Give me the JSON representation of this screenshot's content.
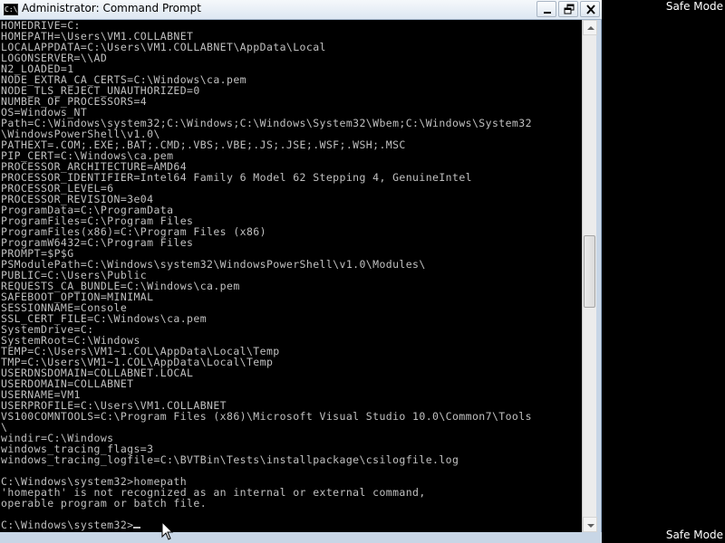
{
  "desktop": {
    "safe_mode_top": "Safe Mode",
    "safe_mode_bottom": "Safe Mode"
  },
  "window": {
    "title": "Administrator: Command Prompt",
    "icon_text": "C:\\",
    "controls": {
      "minimize": "minimize-icon",
      "maximize": "restore-icon",
      "close": "close-icon"
    }
  },
  "console": {
    "text_color": "#c0c0c0",
    "background": "#000000",
    "lines": [
      "HOMEDRIVE=C:",
      "HOMEPATH=\\Users\\VM1.COLLABNET",
      "LOCALAPPDATA=C:\\Users\\VM1.COLLABNET\\AppData\\Local",
      "LOGONSERVER=\\\\AD",
      "N2_LOADED=1",
      "NODE_EXTRA_CA_CERTS=C:\\Windows\\ca.pem",
      "NODE_TLS_REJECT_UNAUTHORIZED=0",
      "NUMBER_OF_PROCESSORS=4",
      "OS=Windows_NT",
      "Path=C:\\Windows\\system32;C:\\Windows;C:\\Windows\\System32\\Wbem;C:\\Windows\\System32",
      "\\WindowsPowerShell\\v1.0\\",
      "PATHEXT=.COM;.EXE;.BAT;.CMD;.VBS;.VBE;.JS;.JSE;.WSF;.WSH;.MSC",
      "PIP_CERT=C:\\Windows\\ca.pem",
      "PROCESSOR_ARCHITECTURE=AMD64",
      "PROCESSOR_IDENTIFIER=Intel64 Family 6 Model 62 Stepping 4, GenuineIntel",
      "PROCESSOR_LEVEL=6",
      "PROCESSOR_REVISION=3e04",
      "ProgramData=C:\\ProgramData",
      "ProgramFiles=C:\\Program Files",
      "ProgramFiles(x86)=C:\\Program Files (x86)",
      "ProgramW6432=C:\\Program Files",
      "PROMPT=$P$G",
      "PSModulePath=C:\\Windows\\system32\\WindowsPowerShell\\v1.0\\Modules\\",
      "PUBLIC=C:\\Users\\Public",
      "REQUESTS_CA_BUNDLE=C:\\Windows\\ca.pem",
      "SAFEBOOT_OPTION=MINIMAL",
      "SESSIONNAME=Console",
      "SSL_CERT_FILE=C:\\Windows\\ca.pem",
      "SystemDrive=C:",
      "SystemRoot=C:\\Windows",
      "TEMP=C:\\Users\\VM1~1.COL\\AppData\\Local\\Temp",
      "TMP=C:\\Users\\VM1~1.COL\\AppData\\Local\\Temp",
      "USERDNSDOMAIN=COLLABNET.LOCAL",
      "USERDOMAIN=COLLABNET",
      "USERNAME=VM1",
      "USERPROFILE=C:\\Users\\VM1.COLLABNET",
      "VS100COMNTOOLS=C:\\Program Files (x86)\\Microsoft Visual Studio 10.0\\Common7\\Tools",
      "\\",
      "windir=C:\\Windows",
      "windows_tracing_flags=3",
      "windows_tracing_logfile=C:\\BVTBin\\Tests\\installpackage\\csilogfile.log",
      "",
      "C:\\Windows\\system32>homepath",
      "'homepath' is not recognized as an internal or external command,",
      "operable program or batch file.",
      "",
      "C:\\Windows\\system32>"
    ]
  }
}
